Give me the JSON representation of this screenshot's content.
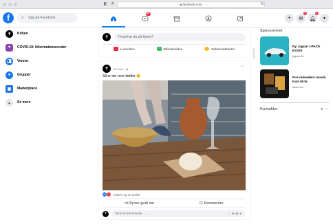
{
  "browser": {
    "url": "facebook.com"
  },
  "topbar": {
    "search_placeholder": "Søg på Facebook",
    "watch_badge": "9+",
    "notif_badge_1": "5",
    "notif_badge_2": "4"
  },
  "sidebar": {
    "items": [
      {
        "label": "Kirken"
      },
      {
        "label": "COVID-19: Informationscenter"
      },
      {
        "label": "Venner"
      },
      {
        "label": "Grupper"
      },
      {
        "label": "Marketplace"
      },
      {
        "label": "Se mere"
      }
    ]
  },
  "composer": {
    "placeholder": "Hvad har du på hjerte?",
    "live": "Livevideo",
    "photo": "Billede/video",
    "feeling": "Følelse/aktivitet"
  },
  "post": {
    "time": "22 timer",
    "text": "Så er der rene fødder 😊",
    "reactions": "Anders og 10 andre",
    "like": "Synes godt om",
    "comment": "Kommenter",
    "comment_placeholder": "Skriv en kommentar ..."
  },
  "right": {
    "sponsored": "Sponsoreret",
    "ads": [
      {
        "title": "Ny Jaguar I-PACE EV320",
        "source": "jaguar.dk"
      },
      {
        "title": "Fire måneders musik. Kun 49 kr.",
        "source": "tidal.com"
      }
    ],
    "contacts": "Kontakter"
  },
  "colors": {
    "brand": "#1877f2",
    "badge": "#e41e3f"
  }
}
